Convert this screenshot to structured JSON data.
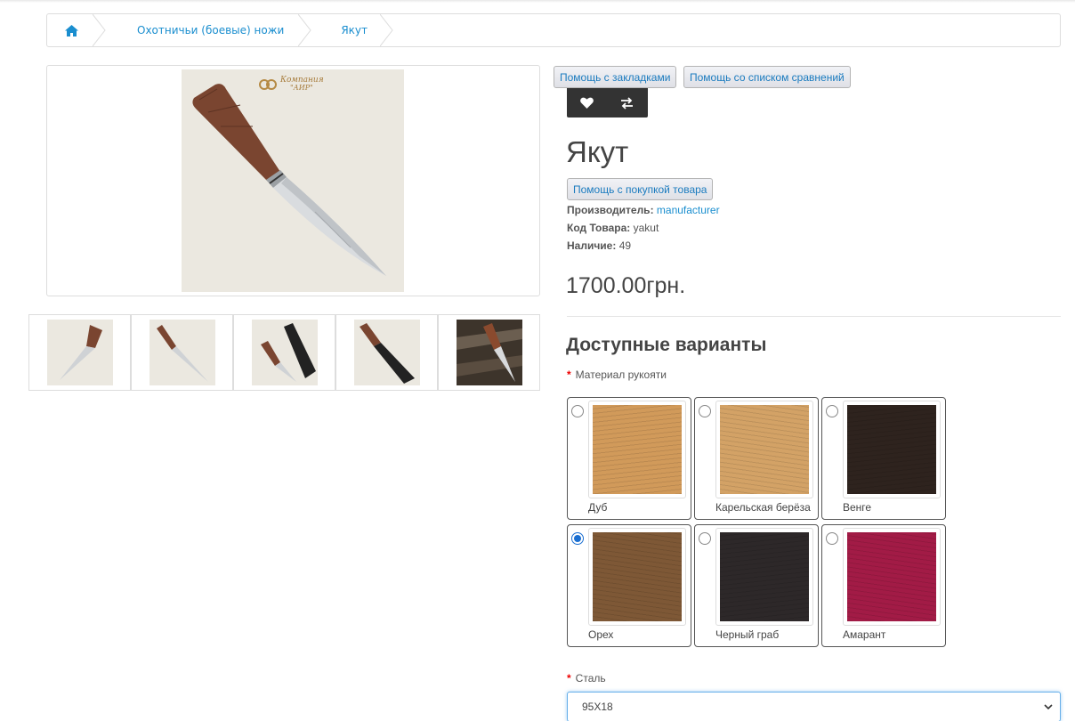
{
  "breadcrumb": {
    "home_icon": "home-icon",
    "items": [
      "Охотничьи (боевые) ножи",
      "Якут"
    ]
  },
  "gallery": {
    "main_image_alt": "Якут",
    "brand_text": "Компания АИР",
    "thumbnail_count": 5
  },
  "help": {
    "bookmarks": "Помощь с закладками",
    "compare": "Помощь со списком сравнений",
    "purchase": "Помощь с покупкой товара"
  },
  "actions": {
    "wishlist_icon": "heart-icon",
    "compare_icon": "exchange-icon"
  },
  "product": {
    "title": "Якут",
    "manufacturer_label": "Производитель:",
    "manufacturer_value": "manufacturer",
    "code_label": "Код Товара:",
    "code_value": "yakut",
    "stock_label": "Наличие:",
    "stock_value": "49",
    "price": "1700.00грн."
  },
  "options": {
    "title": "Доступные варианты",
    "handle_label": "Материал рукояти",
    "handle_choices": [
      {
        "label": "Дуб",
        "color": "#d19a5a",
        "selected": false
      },
      {
        "label": "Карельская берёза",
        "color": "#d3a266",
        "selected": false
      },
      {
        "label": "Венге",
        "color": "#2e231e",
        "selected": false
      },
      {
        "label": "Орех",
        "color": "#7e5836",
        "selected": true
      },
      {
        "label": "Черный граб",
        "color": "#2d2829",
        "selected": false
      },
      {
        "label": "Амарант",
        "color": "#a21b46",
        "selected": false
      }
    ],
    "steel_label": "Сталь",
    "steel_value": "95Х18",
    "required_mark": "*"
  },
  "colors": {
    "link": "#1a8ecf",
    "action_bar": "#333333",
    "required": "#ee0000",
    "radio_checked": "#1b6fd1"
  }
}
